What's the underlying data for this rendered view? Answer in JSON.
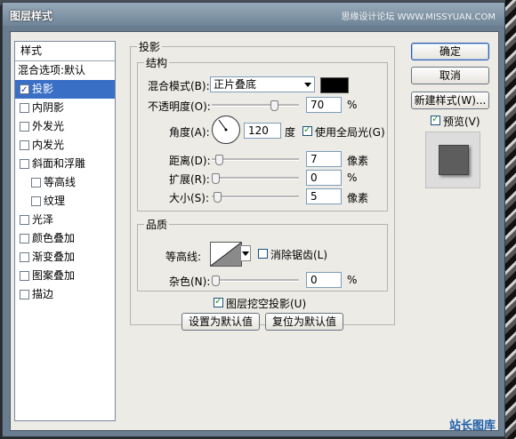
{
  "window": {
    "title": "图层样式",
    "watermark": "思缘设计论坛 WWW.MISSYUAN.COM"
  },
  "sidebar": {
    "header": "样式",
    "blend_options": "混合选项:默认",
    "items": [
      {
        "label": "投影",
        "checked": true,
        "selected": true
      },
      {
        "label": "内阴影",
        "checked": false
      },
      {
        "label": "外发光",
        "checked": false
      },
      {
        "label": "内发光",
        "checked": false
      },
      {
        "label": "斜面和浮雕",
        "checked": false
      },
      {
        "label": "等高线",
        "checked": false,
        "sub": true
      },
      {
        "label": "纹理",
        "checked": false,
        "sub": true
      },
      {
        "label": "光泽",
        "checked": false
      },
      {
        "label": "颜色叠加",
        "checked": false
      },
      {
        "label": "渐变叠加",
        "checked": false
      },
      {
        "label": "图案叠加",
        "checked": false
      },
      {
        "label": "描边",
        "checked": false
      }
    ]
  },
  "drop_shadow": {
    "title": "投影",
    "structure": {
      "title": "结构",
      "blend_mode_label": "混合模式(B):",
      "blend_mode_value": "正片叠底",
      "color": "#000000",
      "opacity_label": "不透明度(O):",
      "opacity_value": "70",
      "opacity_unit": "%",
      "opacity_level": 0.7,
      "angle_label": "角度(A):",
      "angle_value": "120",
      "angle_unit": "度",
      "global_light_label": "使用全局光(G)",
      "global_light_checked": true,
      "distance_label": "距离(D):",
      "distance_value": "7",
      "distance_unit": "像素",
      "spread_label": "扩展(R):",
      "spread_value": "0",
      "spread_unit": "%",
      "size_label": "大小(S):",
      "size_value": "5",
      "size_unit": "像素"
    },
    "quality": {
      "title": "品质",
      "contour_label": "等高线:",
      "antialias_label": "消除锯齿(L)",
      "antialias_checked": false,
      "noise_label": "杂色(N):",
      "noise_value": "0",
      "noise_unit": "%"
    },
    "knockout_label": "图层挖空投影(U)",
    "knockout_checked": true,
    "set_default_label": "设置为默认值",
    "reset_default_label": "复位为默认值"
  },
  "buttons": {
    "ok": "确定",
    "cancel": "取消",
    "new_style": "新建样式(W)...",
    "preview_label": "预览(V)",
    "preview_checked": true
  },
  "footer_logo": "站长图库"
}
